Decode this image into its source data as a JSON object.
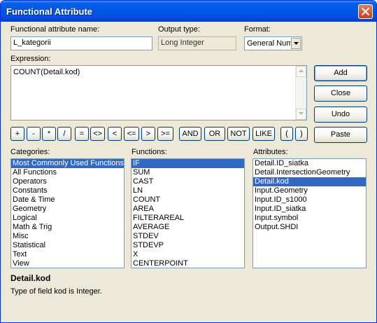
{
  "window": {
    "title": "Functional Attribute"
  },
  "name_label": "Functional attribute name:",
  "name_value": "L_kategorii",
  "output_label": "Output type:",
  "output_value": "Long Integer",
  "format_label": "Format:",
  "format_value": "General Num",
  "expression_label": "Expression:",
  "expression_value": "COUNT(Detail.kod)",
  "buttons": {
    "add": "Add",
    "close": "Close",
    "undo": "Undo",
    "paste": "Paste"
  },
  "operators": [
    "+",
    "-",
    "*",
    "/",
    "=",
    "<>",
    "<",
    "<=",
    ">",
    ">=",
    "AND",
    "OR",
    "NOT",
    "LIKE",
    "(",
    ")"
  ],
  "categories_label": "Categories:",
  "categories": [
    "Most Commonly Used Functions",
    "All Functions",
    "Operators",
    "Constants",
    "Date & Time",
    "Geometry",
    "Logical",
    "Math & Trig",
    "Misc",
    "Statistical",
    "Text",
    "View"
  ],
  "functions_label": "Functions:",
  "functions": [
    "IF",
    "SUM",
    "CAST",
    "LN",
    "COUNT",
    "AREA",
    "FILTERAREAL",
    "AVERAGE",
    "STDEV",
    "STDEVP",
    "X",
    "CENTERPOINT"
  ],
  "attributes_label": "Attributes:",
  "attributes": [
    "Detail.ID_siatka",
    "Detail.IntersectionGeometry",
    "Detail.kod",
    "Input.Geometry",
    "Input.ID_s1000",
    "Input.ID_siatka",
    "Input.symbol",
    "Output.SHDI"
  ],
  "description": {
    "title": "Detail.kod",
    "text": "Type of field kod is Integer."
  },
  "colors": {
    "titlebar": "#0058e6",
    "selection": "#316ac5",
    "dialog_bg": "#ece9d8"
  }
}
